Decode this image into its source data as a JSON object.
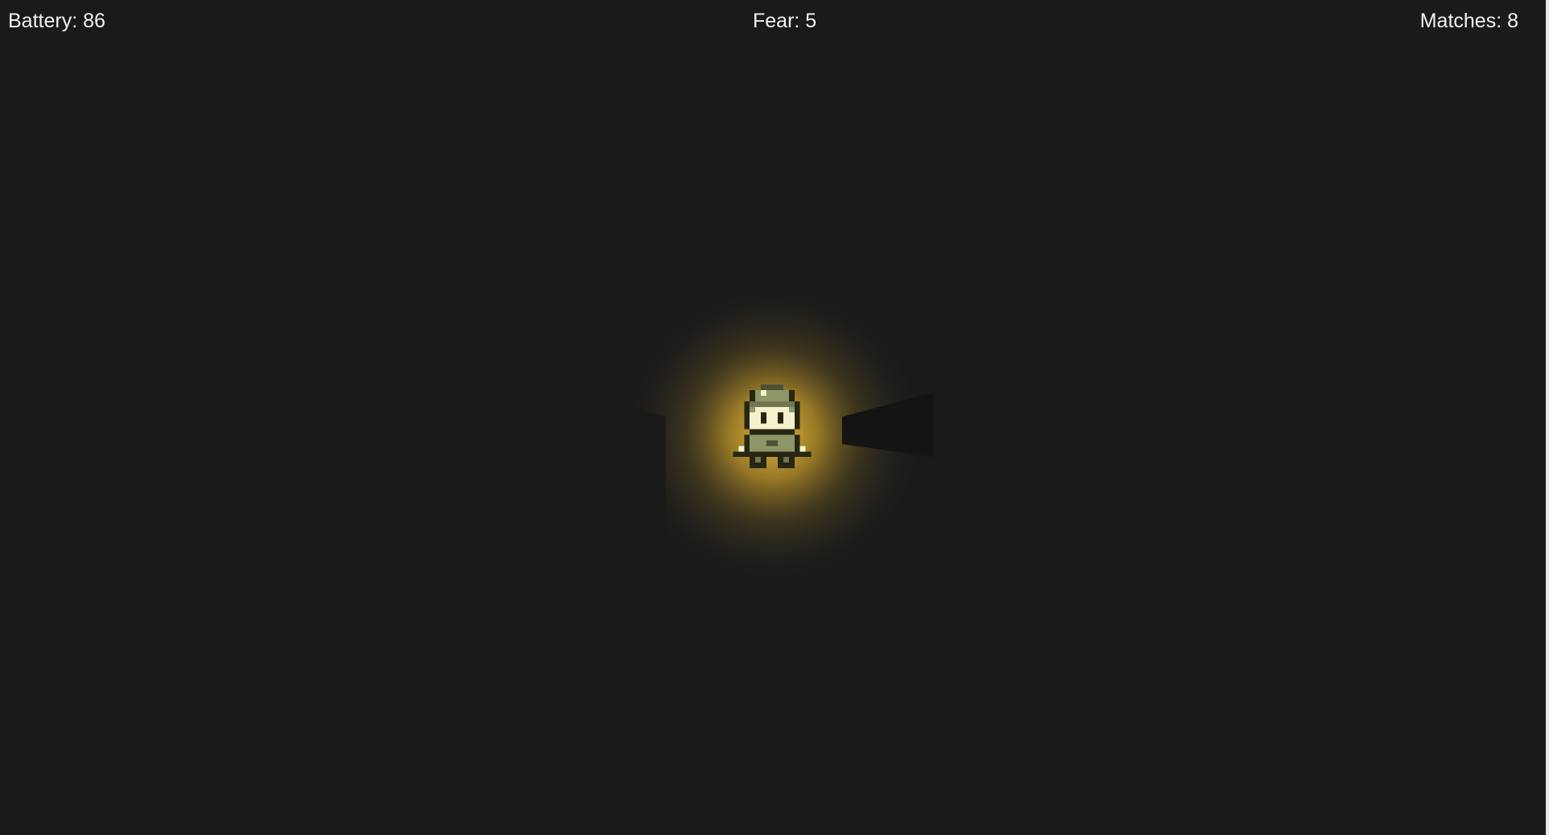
{
  "hud": {
    "battery_label": "Battery: 86",
    "fear_label": "Fear: 5",
    "matches_label": "Matches: 8"
  },
  "stats": {
    "battery": 86,
    "fear": 5,
    "matches": 8
  },
  "colors": {
    "background": "#1a1a1a",
    "light_glow": "#f0c040",
    "hud_text": "#f2f2f2",
    "sprite_outline": "#262611",
    "sprite_mid": "#8e9567",
    "sprite_light": "#f4f2cc",
    "wall_shadow": "#121212"
  }
}
